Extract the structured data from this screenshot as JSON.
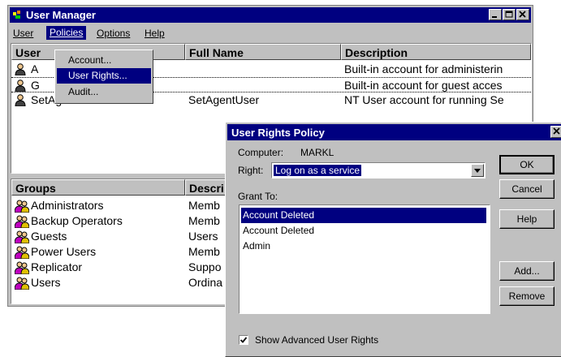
{
  "user_manager": {
    "title": "User Manager",
    "controls": {
      "minimize": "_",
      "maximize": "□",
      "close": "✕"
    },
    "menubar": [
      "User",
      "Policies",
      "Options",
      "Help"
    ],
    "users": {
      "columns": [
        "User",
        "Full Name",
        "Description"
      ],
      "rows": [
        {
          "user": "A",
          "full_name": "",
          "description": "Built-in account for administerin"
        },
        {
          "user": "G",
          "full_name": "",
          "description": "Built-in account for guest acces"
        },
        {
          "user": "SetAgentUser",
          "full_name": "SetAgentUser",
          "description": "NT User account for running Se"
        }
      ]
    },
    "groups": {
      "columns": [
        "Groups",
        "Descri"
      ],
      "rows": [
        {
          "name": "Administrators",
          "description": "Memb"
        },
        {
          "name": "Backup Operators",
          "description": "Memb"
        },
        {
          "name": "Guests",
          "description": "Users"
        },
        {
          "name": "Power Users",
          "description": "Memb"
        },
        {
          "name": "Replicator",
          "description": "Suppo"
        },
        {
          "name": "Users",
          "description": "Ordina"
        }
      ]
    },
    "policies_menu": [
      "Account...",
      "User Rights...",
      "Audit..."
    ]
  },
  "dialog": {
    "title": "User Rights Policy",
    "close": "✕",
    "computer_label": "Computer:",
    "computer_value": "MARKL",
    "right_label": "Right:",
    "right_value": "Log on as a service",
    "grant_label": "Grant To:",
    "grant_list": [
      "Account Deleted",
      "Account Deleted",
      "Admin"
    ],
    "buttons": {
      "ok": "OK",
      "cancel": "Cancel",
      "help": "Help",
      "add": "Add...",
      "remove": "Remove"
    },
    "checkbox_label": "Show Advanced User Rights",
    "checkbox_checked": true
  },
  "colors": {
    "titlebar": "#000080",
    "face": "#c0c0c0",
    "selection": "#000080"
  }
}
